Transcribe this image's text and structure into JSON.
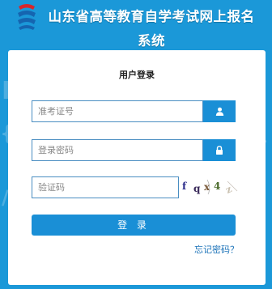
{
  "header": {
    "title": "山东省高等教育自学考试网上报名系统",
    "logo_icon": "exam-authority-logo-icon"
  },
  "login": {
    "title": "用户登录",
    "exam_number_placeholder": "准考证号",
    "password_placeholder": "登录密码",
    "captcha_placeholder": "验证码",
    "user_icon": "user-icon",
    "lock_icon": "lock-icon",
    "captcha_chars": [
      "f",
      "q",
      "x",
      "4",
      "z"
    ],
    "submit_label": "登 录",
    "forgot_label": "忘记密码？"
  },
  "colors": {
    "background": "#1b98d8",
    "accent": "#1a8fd6",
    "field_border": "#4a8ec2",
    "link": "#1a72b8"
  }
}
